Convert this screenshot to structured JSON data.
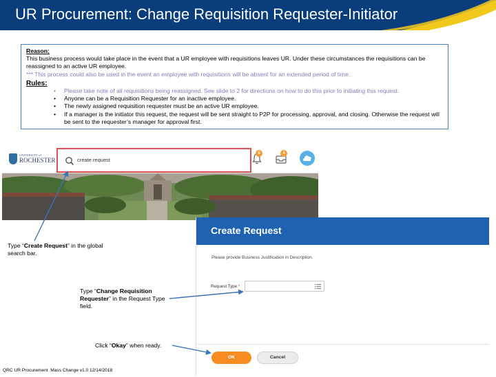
{
  "slide": {
    "title": "UR Procurement: Change Requisition Requester-Initiator",
    "footer": "QRC UR Procurement  Mass Change v1.0 12/14/2018",
    "colors": {
      "banner_blue": "#0a3d7c",
      "banner_gold": "#f2c81d",
      "workday_blue": "#1f62b2",
      "ok_orange": "#f68c22",
      "arrow_blue": "#3d74b5"
    }
  },
  "info_box": {
    "reason_heading": "Reason:",
    "reason_text": "This business process would take place in the event that a UR employee with requisitions leaves UR. Under these circumstances the requisitions can be reassigned to an active UR employee.",
    "reason_note": "*** This process could also be used in the event an employee with requisitions will be absent for an extended period of time.",
    "rules_heading": "Rules:",
    "rules": [
      "Please take note of all requisitions being reassigned. See slide to 2 for directions on how to do this prior to initiating this request.",
      "Anyone can be a Requisition Requester for an inactive employee.",
      "The newly assigned requisition requester must be an active UR employee.",
      "If a manager is the initiator this request, the request will be sent straight to P2P for processing, approval, and closing. Otherwise the request will be sent to the requester’s manager for approval first."
    ]
  },
  "workday_header": {
    "logo_small": "UNIVERSITY of",
    "logo_big": "ROCHESTER",
    "search_value": "create request",
    "notification_count": "6",
    "inbox_count": "4",
    "icons": [
      "search-icon",
      "bell-icon",
      "inbox-icon",
      "cloud-icon"
    ]
  },
  "create_request": {
    "title": "Create Request",
    "description": "Please provide Business Justification in Description.",
    "request_type_label": "Request Type",
    "required_marker": "*",
    "request_type_value": "",
    "ok_label": "OK",
    "cancel_label": "Cancel"
  },
  "callouts": {
    "c1_pre": "Type “",
    "c1_bold": "Create Request",
    "c1_post": "” in the global search bar.",
    "c2_pre": "Type “",
    "c2_bold": "Change Requisition Requester",
    "c2_post": "” in the Request Type field.",
    "c3_pre": "Click “",
    "c3_bold": "Okay",
    "c3_post": "” when ready."
  }
}
